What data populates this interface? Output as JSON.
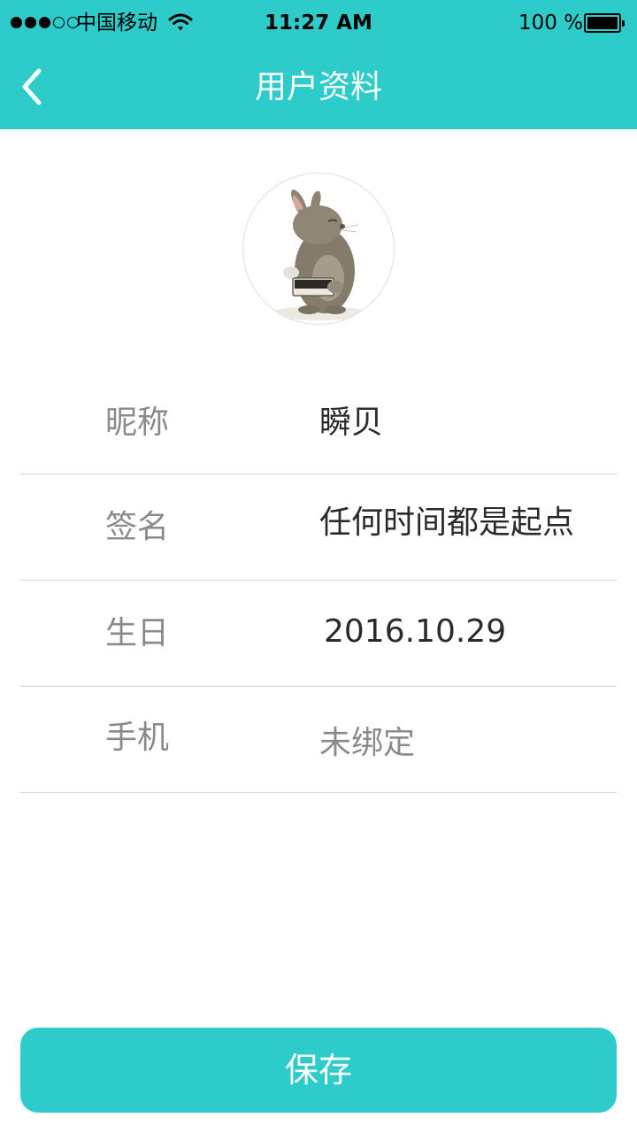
{
  "status_bar": {
    "carrier": "中国移动",
    "time": "11:27 AM",
    "battery": "100 %",
    "signal_bars": 3,
    "signal_total": 5
  },
  "header": {
    "back_icon": "chevron-left-icon",
    "title": "用户资料",
    "background_color": "#2ecbcb"
  },
  "profile": {
    "avatar_icon": "rabbit-avatar",
    "fields": [
      {
        "label": "昵称",
        "value": "瞬贝"
      },
      {
        "label": "签名",
        "value": "任何时间都是起点"
      },
      {
        "label": "生日",
        "value": "2016.10.29"
      },
      {
        "label": "手机",
        "value": "未绑定"
      }
    ]
  },
  "actions": {
    "save_label": "保存",
    "accent_color": "#2ecbcb"
  }
}
